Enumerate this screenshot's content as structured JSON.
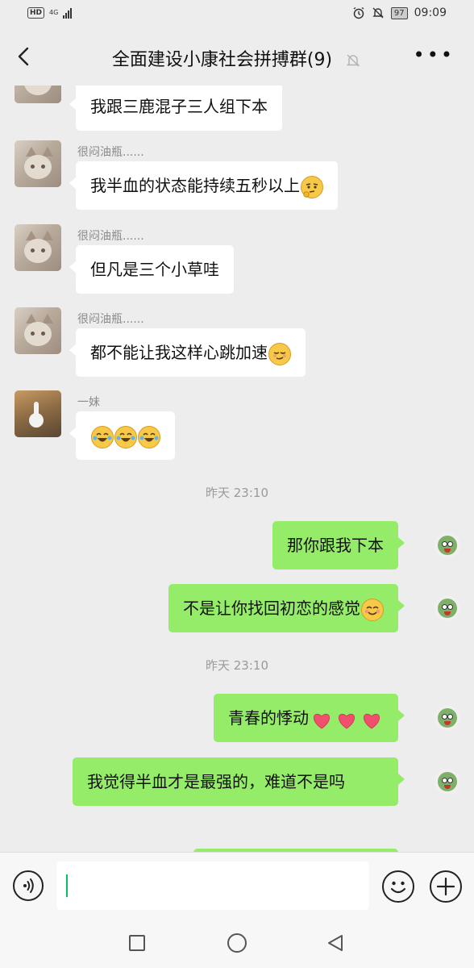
{
  "status_bar": {
    "network_badge": "HD",
    "network_type": "4G",
    "battery": "97",
    "time": "09:09"
  },
  "header": {
    "title": "全面建设小康社会拼搏群(9)",
    "back_icon": "chevron-left-icon",
    "mute_icon": "bell-off-icon",
    "more_icon": "ellipsis-icon"
  },
  "messages": [
    {
      "side": "left",
      "sender": "",
      "text": "我跟三鹿混子三人组下本",
      "emoji": ""
    },
    {
      "side": "left",
      "sender": "很闷油瓶......",
      "text": "我半血的状态能持续五秒以上",
      "emoji": "thinking-face"
    },
    {
      "side": "left",
      "sender": "很闷油瓶......",
      "text": "但凡是三个小草哇",
      "emoji": ""
    },
    {
      "side": "left",
      "sender": "很闷油瓶......",
      "text": "都不能让我这样心跳加速",
      "emoji": "smirk-face"
    },
    {
      "side": "left",
      "sender": "一妹",
      "text": "",
      "emoji": "tears-of-joy x3"
    },
    {
      "timestamp": "昨天 23:10"
    },
    {
      "side": "right",
      "text": "那你跟我下本",
      "emoji": ""
    },
    {
      "side": "right",
      "text": "不是让你找回初恋的感觉",
      "emoji": "blush-face"
    },
    {
      "timestamp": "昨天 23:10"
    },
    {
      "side": "right",
      "text": "青春的悸动",
      "emoji": "heart x3"
    },
    {
      "side": "right",
      "text": "我觉得半血才是最强的，难道不是吗",
      "emoji": ""
    }
  ],
  "colors": {
    "background": "#ededed",
    "outgoing_bubble": "#95ec69",
    "incoming_bubble": "#ffffff",
    "caret": "#07c160"
  },
  "input_bar": {
    "voice_icon": "voice-icon",
    "emoji_icon": "emoji-icon",
    "plus_icon": "plus-icon",
    "value": ""
  },
  "nav_bar": {
    "recent_icon": "square-icon",
    "home_icon": "circle-icon",
    "back_icon": "triangle-back-icon"
  }
}
